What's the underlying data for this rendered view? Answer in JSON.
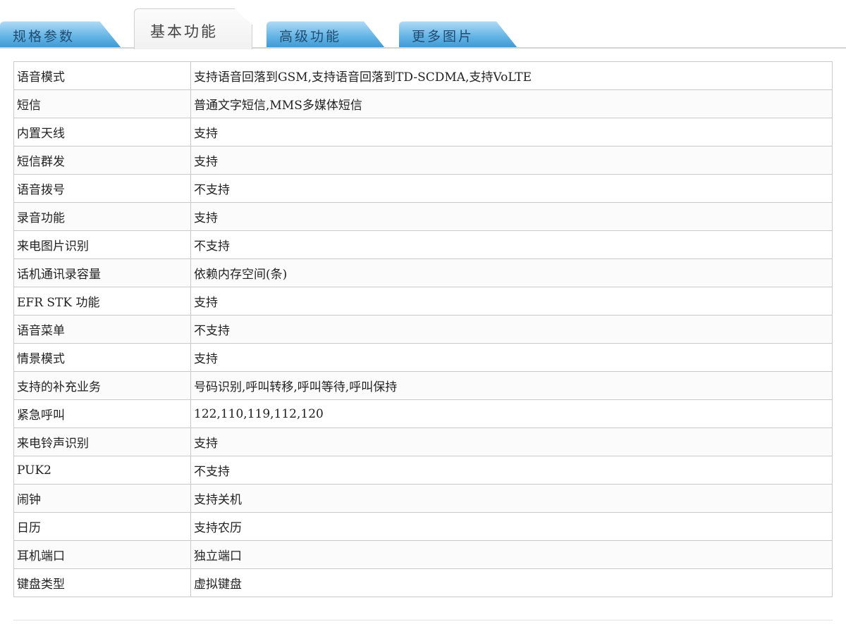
{
  "tabs": [
    {
      "label": "规格参数",
      "active": false
    },
    {
      "label": "基本功能",
      "active": true
    },
    {
      "label": "高级功能",
      "active": false
    },
    {
      "label": "更多图片",
      "active": false
    }
  ],
  "colors": {
    "tab_inactive": "#5fb2e4",
    "tab_active": "#f4f4f4",
    "border": "#c9c9c9"
  },
  "table": {
    "rows": [
      {
        "label": "语音模式",
        "value": "支持语音回落到GSM,支持语音回落到TD-SCDMA,支持VoLTE"
      },
      {
        "label": "短信",
        "value": "普通文字短信,MMS多媒体短信"
      },
      {
        "label": "内置天线",
        "value": "支持"
      },
      {
        "label": "短信群发",
        "value": "支持"
      },
      {
        "label": "语音拨号",
        "value": "不支持"
      },
      {
        "label": "录音功能",
        "value": "支持"
      },
      {
        "label": "来电图片识别",
        "value": "不支持"
      },
      {
        "label": "话机通讯录容量",
        "value": "依赖内存空间(条)"
      },
      {
        "label": "EFR STK 功能",
        "value": "支持"
      },
      {
        "label": "语音菜单",
        "value": "不支持"
      },
      {
        "label": "情景模式",
        "value": "支持"
      },
      {
        "label": "支持的补充业务",
        "value": "号码识别,呼叫转移,呼叫等待,呼叫保持"
      },
      {
        "label": "紧急呼叫",
        "value": "122,110,119,112,120"
      },
      {
        "label": "来电铃声识别",
        "value": "支持"
      },
      {
        "label": "PUK2",
        "value": "不支持"
      },
      {
        "label": "闹钟",
        "value": "支持关机"
      },
      {
        "label": "日历",
        "value": "支持农历"
      },
      {
        "label": "耳机端口",
        "value": "独立端口"
      },
      {
        "label": "键盘类型",
        "value": "虚拟键盘"
      }
    ]
  }
}
